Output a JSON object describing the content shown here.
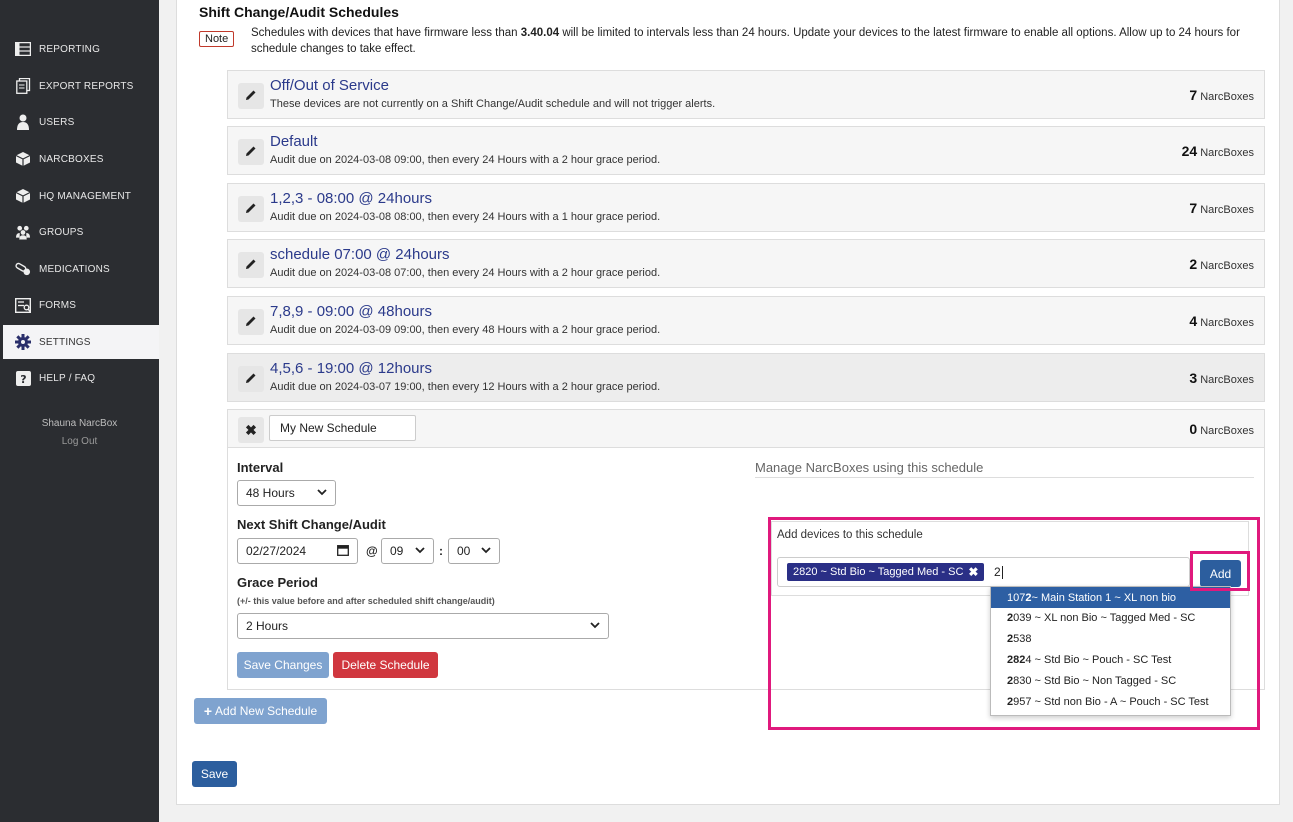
{
  "sidebar": {
    "items": [
      {
        "label": "REPORTING",
        "icon": "table-icon",
        "active": false
      },
      {
        "label": "EXPORT REPORTS",
        "icon": "documents-icon",
        "active": false
      },
      {
        "label": "USERS",
        "icon": "user-icon",
        "active": false
      },
      {
        "label": "NARCBOXES",
        "icon": "box-icon",
        "active": false
      },
      {
        "label": "HQ MANAGEMENT",
        "icon": "box-icon",
        "active": false
      },
      {
        "label": "GROUPS",
        "icon": "group-icon",
        "active": false
      },
      {
        "label": "MEDICATIONS",
        "icon": "pills-icon",
        "active": false
      },
      {
        "label": "FORMS",
        "icon": "form-icon",
        "active": false
      },
      {
        "label": "SETTINGS",
        "icon": "gear-icon",
        "active": true
      },
      {
        "label": "HELP / FAQ",
        "icon": "help-icon",
        "active": false
      }
    ],
    "user_name": "Shauna NarcBox",
    "logout_label": "Log Out"
  },
  "main": {
    "title": "Shift Change/Audit Schedules",
    "note_label": "Note",
    "note_pre": "Schedules with devices that have firmware less than ",
    "note_version": "3.40.04",
    "note_post": " will be limited to intervals less than 24 hours. Update your devices to the latest firmware to enable all options. Allow up to 24 hours for schedule changes to take effect.",
    "count_unit": "NarcBoxes",
    "schedules": [
      {
        "name": "Off/Out of Service",
        "desc": "These devices are not currently on a Shift Change/Audit schedule and will not trigger alerts.",
        "count": "7"
      },
      {
        "name": "Default",
        "desc": "Audit due on 2024-03-08 09:00, then every 24 Hours with a 2 hour grace period.",
        "count": "24"
      },
      {
        "name": "1,2,3 - 08:00 @ 24hours",
        "desc": "Audit due on 2024-03-08 08:00, then every 24 Hours with a 1 hour grace period.",
        "count": "7"
      },
      {
        "name": "schedule 07:00 @ 24hours",
        "desc": "Audit due on 2024-03-08 07:00, then every 24 Hours with a 2 hour grace period.",
        "count": "2"
      },
      {
        "name": "7,8,9 - 09:00 @ 48hours",
        "desc": "Audit due on 2024-03-09 09:00, then every 48 Hours with a 2 hour grace period.",
        "count": "4"
      },
      {
        "name": "4,5,6 - 19:00 @ 12hours",
        "desc": "Audit due on 2024-03-07 19:00, then every 12 Hours with a 2 hour grace period.",
        "count": "3"
      }
    ],
    "new_schedule": {
      "name_value": "My New Schedule",
      "count": "0",
      "interval_label": "Interval",
      "interval_value": "48 Hours",
      "next_label": "Next Shift Change/Audit",
      "date_value": "02/27/2024",
      "at_symbol": "@",
      "hour_value": "09",
      "colon": ":",
      "minute_value": "00",
      "grace_label": "Grace Period",
      "grace_hint": "(+/- this value before and after scheduled shift change/audit)",
      "grace_value": "2 Hours",
      "save_changes_label": "Save Changes",
      "delete_label": "Delete Schedule",
      "manage_title": "Manage NarcBoxes using this schedule",
      "add_devices_label": "Add devices to this schedule",
      "selected_device": "2820 ~ Std Bio ~ Tagged Med - SC",
      "search_value": "2",
      "add_label": "Add",
      "suggestions": [
        {
          "pre": "107",
          "match": "2",
          "post": " ~ Main Station 1 ~ XL non bio",
          "selected": true
        },
        {
          "pre": "",
          "match": "2",
          "post": "039 ~ XL non Bio ~ Tagged Med - SC",
          "selected": false
        },
        {
          "pre": "",
          "match": "2",
          "post": "538",
          "selected": false
        },
        {
          "pre": "",
          "match": "282",
          "post": "4 ~ Std Bio ~ Pouch - SC Test",
          "selected": false
        },
        {
          "pre": "",
          "match": "2",
          "post": "830 ~ Std Bio ~ Non Tagged - SC",
          "selected": false
        },
        {
          "pre": "",
          "match": "2",
          "post": "957 ~ Std non Bio - A ~ Pouch - SC Test",
          "selected": false
        }
      ]
    },
    "add_new_label": "Add New Schedule",
    "add_new_plus": "+",
    "save_label": "Save"
  },
  "colors": {
    "sidebar_bg": "#2b2d31",
    "link_blue": "#2b3a8b",
    "primary_button": "#2c5e9e",
    "disabled_button": "#7fa3cf",
    "danger_button": "#d0373f",
    "highlight": "#e0197d"
  }
}
